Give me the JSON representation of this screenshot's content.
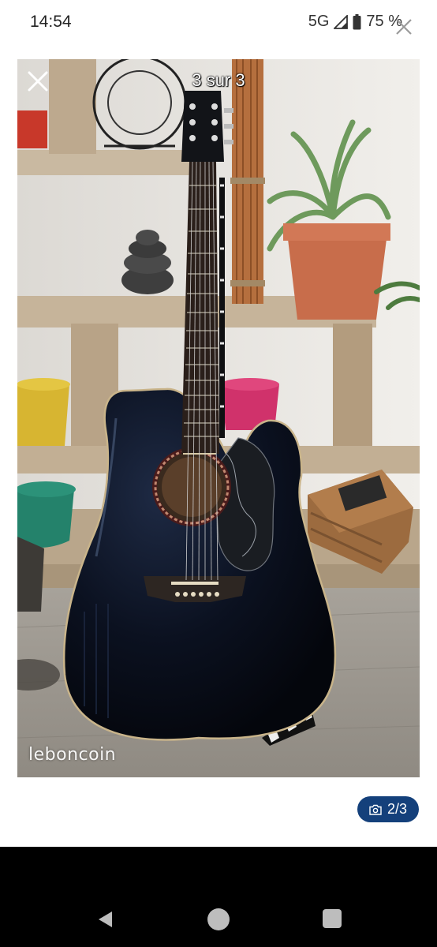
{
  "status_bar": {
    "time": "14:54",
    "network": "5G",
    "battery": "75 %",
    "icons": [
      "signal-icon",
      "battery-icon"
    ]
  },
  "viewer": {
    "counter": "3 sur 3",
    "watermark": "leboncoin",
    "close_icon": "close-icon"
  },
  "background": {
    "close_icon": "close-icon"
  },
  "photo_count": {
    "label": "2/3",
    "icon": "camera-icon",
    "color": "#14407b"
  },
  "nav_bar": {
    "icons": [
      "back-icon",
      "home-icon",
      "recents-icon"
    ]
  }
}
